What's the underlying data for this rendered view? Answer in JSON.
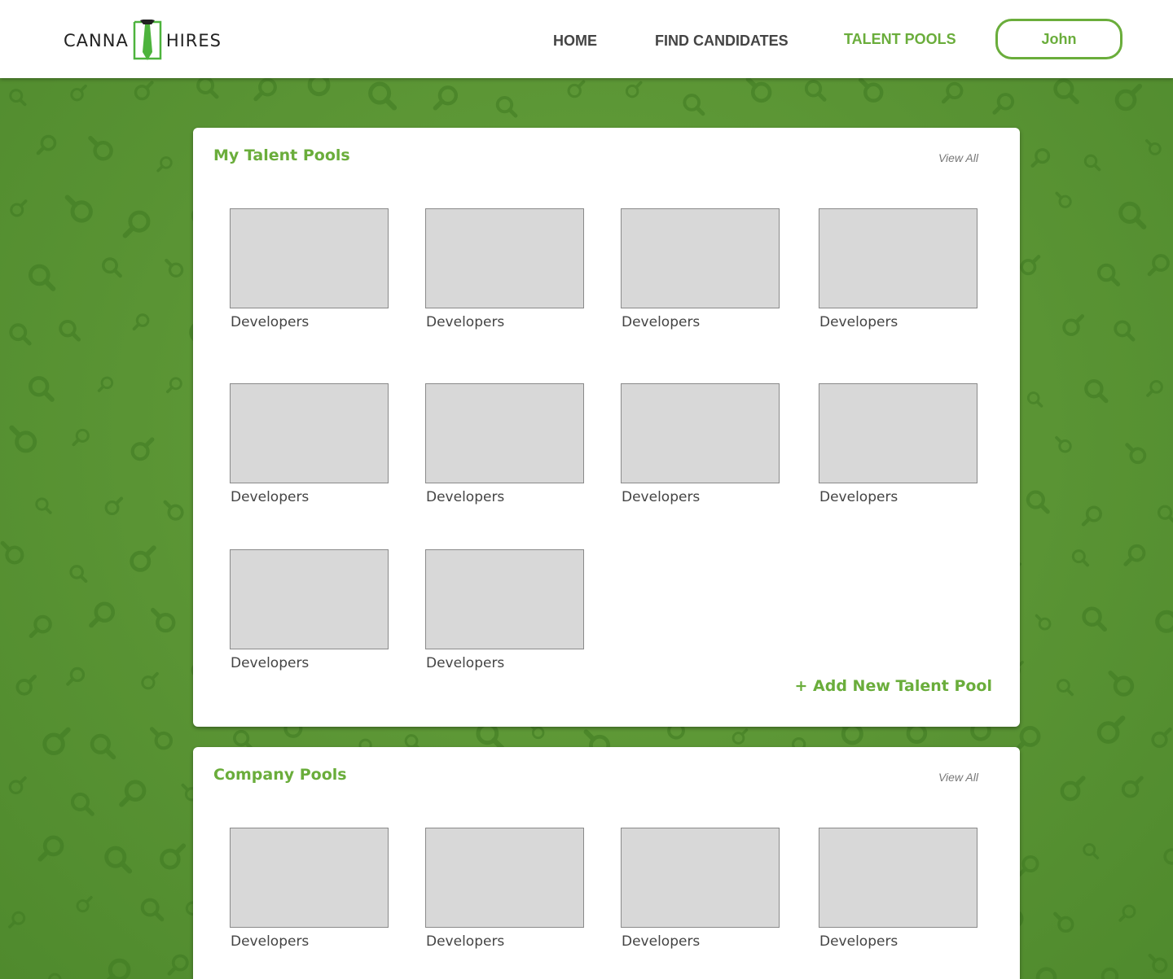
{
  "brand": {
    "logo_left": "CANNA",
    "logo_right": "HIRES",
    "accent": "#6aad3b"
  },
  "nav": {
    "home": "HOME",
    "find_candidates": "FIND CANDIDATES",
    "talent_pools": "TALENT POOLS",
    "user": "John"
  },
  "my_pools": {
    "title": "My Talent Pools",
    "view_all": "View All",
    "tiles": [
      "Developers",
      "Developers",
      "Developers",
      "Developers",
      "Developers",
      "Developers",
      "Developers",
      "Developers",
      "Developers",
      "Developers"
    ],
    "add_label": "+ Add New Talent Pool"
  },
  "company_pools": {
    "title": "Company Pools",
    "view_all": "View All",
    "tiles": [
      "Developers",
      "Developers",
      "Developers",
      "Developers"
    ]
  },
  "icons": {
    "background_pattern": "magnifier-icon",
    "logo_mark": "tie-icon"
  }
}
